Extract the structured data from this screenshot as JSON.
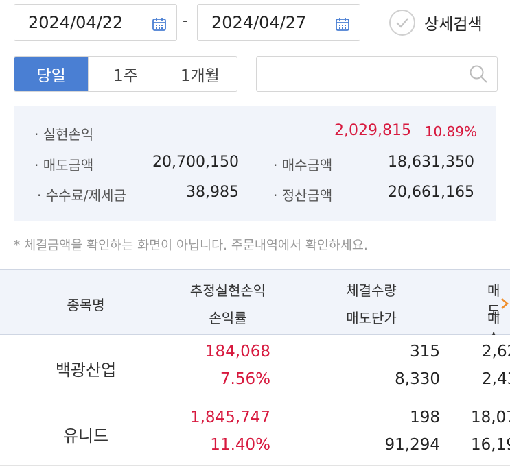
{
  "date_range": {
    "start": "2024/04/22",
    "separator": "-",
    "end": "2024/04/27",
    "detail_search_label": "상세검색"
  },
  "period_tabs": [
    {
      "label": "당일",
      "active": true
    },
    {
      "label": "1주",
      "active": false
    },
    {
      "label": "1개월",
      "active": false
    }
  ],
  "search": {
    "value": "",
    "placeholder": ""
  },
  "summary": {
    "realized_pl": {
      "label": "· 실현손익",
      "value": "2,029,815",
      "rate": "10.89%"
    },
    "sell_amount": {
      "label": "· 매도금액",
      "value": "20,700,150"
    },
    "buy_amount": {
      "label": "· 매수금액",
      "value": "18,631,350"
    },
    "fee_tax": {
      "label": "· 수수료/제세금",
      "value": "38,985"
    },
    "settlement": {
      "label": "· 정산금액",
      "value": "20,661,165"
    }
  },
  "notice": "* 체결금액을 확인하는 화면이 아닙니다. 주문내역에서 확인하세요.",
  "table": {
    "headers": {
      "stock_name": "종목명",
      "est_pl": "추정실현손익",
      "pl_rate": "손익률",
      "exec_qty": "체결수량",
      "sell_price": "매도단가",
      "col4_top": "매도",
      "col4_bottom": "매수"
    },
    "rows": [
      {
        "name": "백광산업",
        "pl": "184,068",
        "rate": "7.56%",
        "qty": "315",
        "price": "8,330",
        "c4a": "2,62",
        "c4b": "2,43"
      },
      {
        "name": "유니드",
        "pl": "1,845,747",
        "rate": "11.40%",
        "qty": "198",
        "price": "91,294",
        "c4a": "18,07",
        "c4b": "16,19"
      }
    ]
  },
  "colors": {
    "accent": "#4a7fd3",
    "profit_red": "#d7193e",
    "panel_bg": "#f1f4fa",
    "arrow_orange": "#f0902e"
  }
}
